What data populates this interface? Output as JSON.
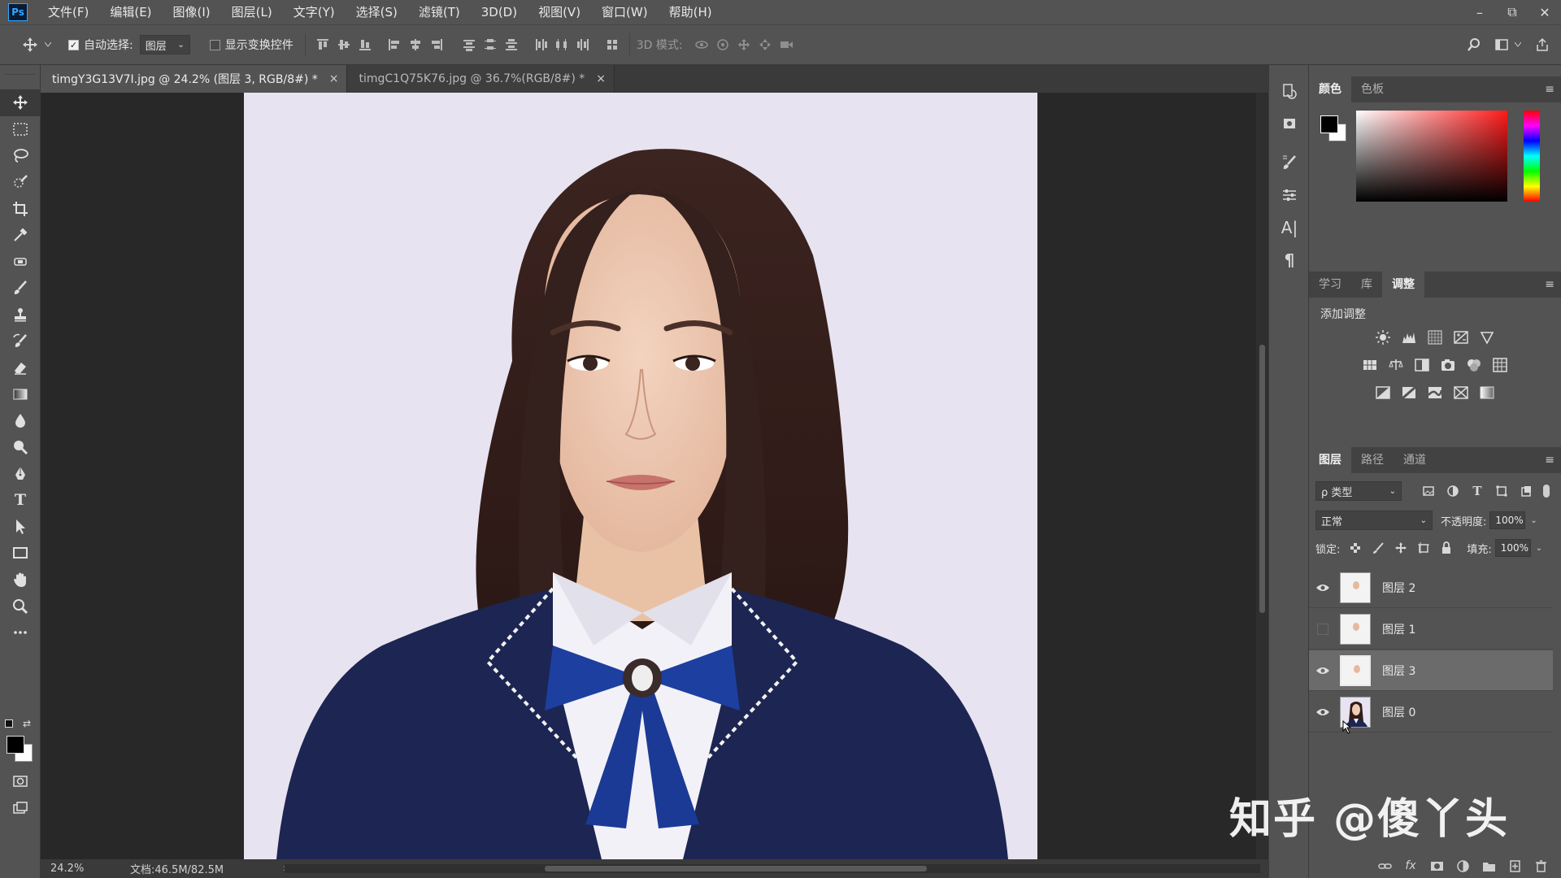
{
  "app": {
    "logo": "Ps"
  },
  "menu": [
    "文件(F)",
    "编辑(E)",
    "图像(I)",
    "图层(L)",
    "文字(Y)",
    "选择(S)",
    "滤镜(T)",
    "3D(D)",
    "视图(V)",
    "窗口(W)",
    "帮助(H)"
  ],
  "window_controls": {
    "minimize": "–",
    "restore": "⧉",
    "close": "✕"
  },
  "options": {
    "auto_select_label": "自动选择:",
    "auto_select_checked": true,
    "auto_select_target": "图层",
    "show_transform_label": "显示变换控件",
    "show_transform_checked": false,
    "mode_3d_label": "3D 模式:"
  },
  "tabs": [
    {
      "title": "timgY3G13V7I.jpg @ 24.2% (图层 3, RGB/8#) *",
      "active": true,
      "close": "×"
    },
    {
      "title": "timgC1Q75K76.jpg @ 36.7%(RGB/8#) *",
      "active": false,
      "close": "×"
    }
  ],
  "status": {
    "zoom": "24.2%",
    "doc_info": "文档:46.5M/82.5M",
    "arrow": "›"
  },
  "color_panel": {
    "tabs": [
      "颜色",
      "色板"
    ],
    "foreground": "#000000",
    "background": "#ffffff"
  },
  "adjust_panel": {
    "tabs": [
      "学习",
      "库",
      "调整"
    ],
    "title": "添加调整"
  },
  "layers_panel": {
    "tabs": [
      "图层",
      "路径",
      "通道"
    ],
    "filter_kind": "ρ 类型",
    "blend_mode": "正常",
    "opacity_label": "不透明度:",
    "opacity_value": "100%",
    "lock_label": "锁定:",
    "fill_label": "填充:",
    "fill_value": "100%",
    "layers": [
      {
        "name": "图层 2",
        "visible": true,
        "selected": false,
        "photo": false
      },
      {
        "name": "图层 1",
        "visible": false,
        "selected": false,
        "photo": false
      },
      {
        "name": "图层 3",
        "visible": true,
        "selected": true,
        "photo": false
      },
      {
        "name": "图层 0",
        "visible": true,
        "selected": false,
        "photo": true
      }
    ],
    "footer_fx": "fx"
  },
  "watermark": "知乎 @傻丫头",
  "colors": {
    "accent": "#31a8ff",
    "panel": "#535353",
    "canvas_bg": "#282828",
    "blazer": "#1d2552",
    "ribbon": "#1d3fa0"
  }
}
